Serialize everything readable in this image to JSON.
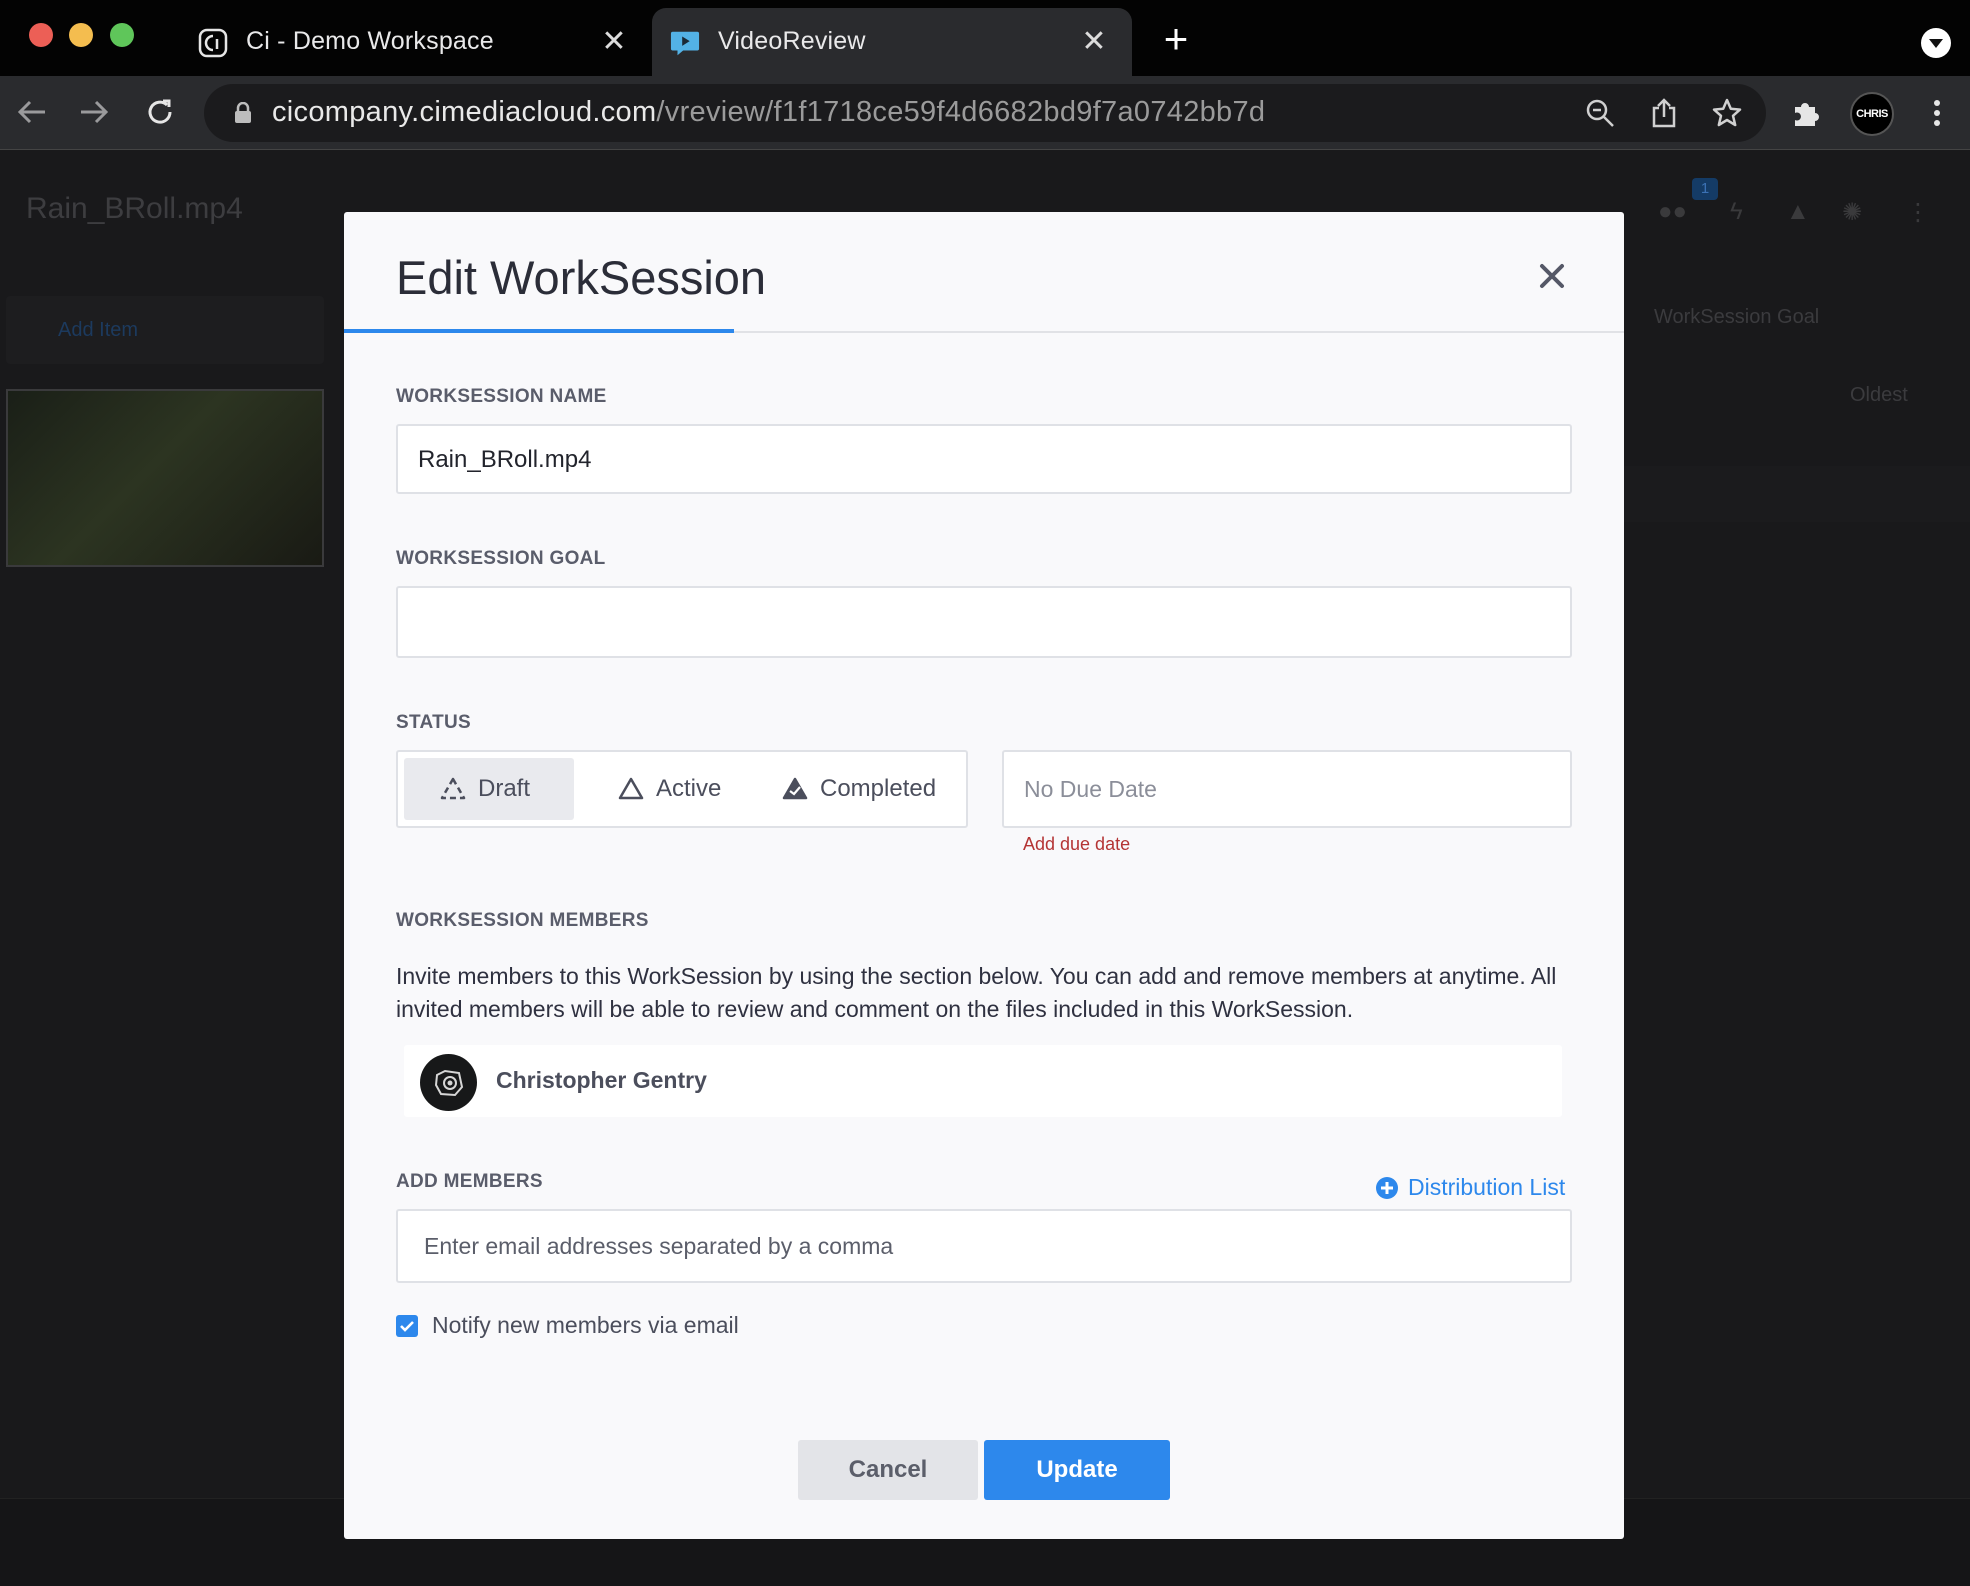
{
  "browser": {
    "tabs": [
      {
        "title": "Ci - Demo Workspace",
        "active": false
      },
      {
        "title": "VideoReview",
        "active": true
      }
    ],
    "url_host": "cicompany.cimediacloud.com",
    "url_path": "/vreview/f1f1718ce59f4d6682bd9f7a0742bb7d",
    "profile_label": "CHRIS"
  },
  "app": {
    "title": "Rain_BRoll.mp4",
    "add_item_label": "Add Item",
    "members_badge": "1",
    "right_tab_label": "WorkSession Goal",
    "sort_label": "Oldest"
  },
  "modal": {
    "title": "Edit WorkSession",
    "name_label": "WORKSESSION NAME",
    "name_value": "Rain_BRoll.mp4",
    "goal_label": "WORKSESSION GOAL",
    "goal_value": "",
    "status_label": "STATUS",
    "status_options": [
      {
        "label": "Draft",
        "selected": true
      },
      {
        "label": "Active",
        "selected": false
      },
      {
        "label": "Completed",
        "selected": false
      }
    ],
    "due_date_value": "No Due Date",
    "add_due_date_label": "Add due date",
    "members_label": "WORKSESSION MEMBERS",
    "members_description": "Invite members to this WorkSession by using the section below. You can add and remove members at anytime. All invited members will be able to review and comment on the files included in this WorkSession.",
    "members": [
      {
        "name": "Christopher Gentry"
      }
    ],
    "add_members_label": "ADD MEMBERS",
    "distribution_list_label": "Distribution List",
    "email_placeholder": "Enter email addresses separated by a comma",
    "notify_label": "Notify new members via email",
    "notify_checked": true,
    "cancel_label": "Cancel",
    "update_label": "Update"
  },
  "colors": {
    "accent": "#2d88ec",
    "error": "#b43434"
  }
}
